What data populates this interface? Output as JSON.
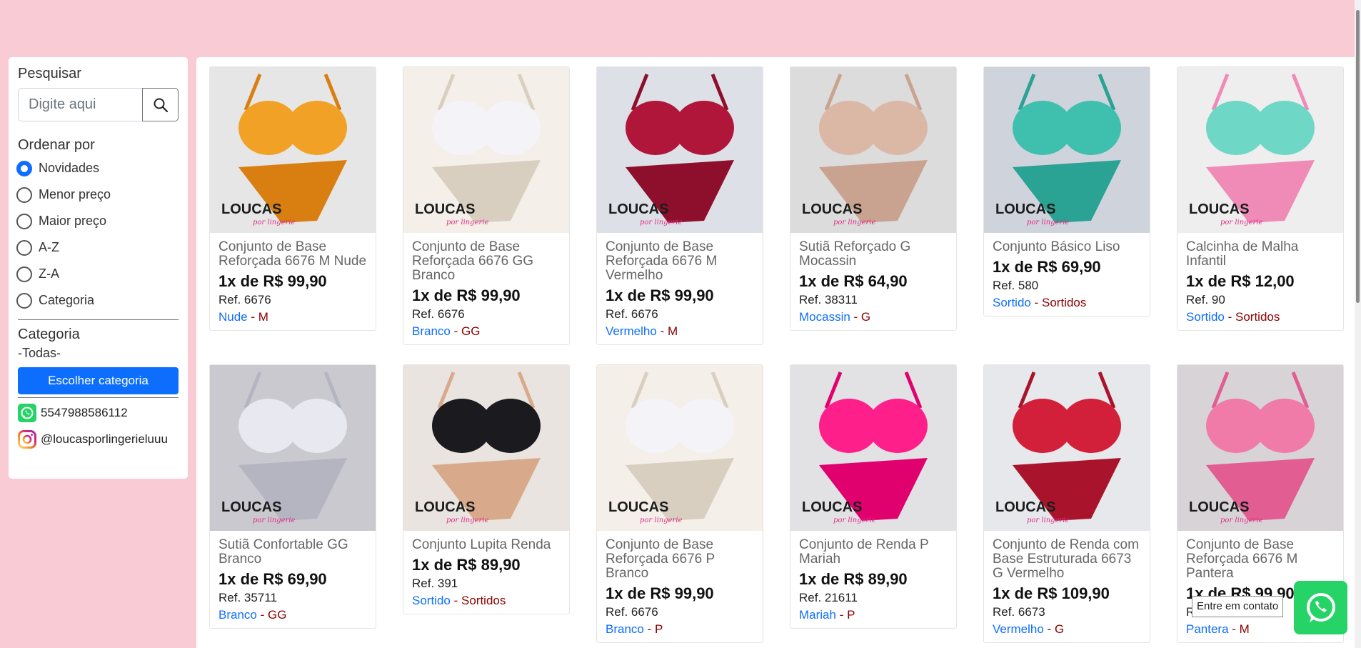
{
  "sidebar": {
    "search": {
      "heading": "Pesquisar",
      "placeholder": "Digite aqui"
    },
    "sort": {
      "heading": "Ordenar por",
      "options": [
        "Novidades",
        "Menor preço",
        "Maior preço",
        "A-Z",
        "Z-A",
        "Categoria"
      ],
      "selected": "Novidades"
    },
    "category": {
      "heading": "Categoria",
      "value": "-Todas-",
      "button": "Escolher categoria"
    },
    "contacts": {
      "whatsapp": "5547988586112",
      "instagram": "@loucasporlingerieluuu"
    }
  },
  "products": [
    {
      "title": "Conjunto de Base Reforçada 6676 M Nude",
      "price": "1x de R$ 99,90",
      "ref": "Ref. 6676",
      "color": "Nude",
      "sep": " - ",
      "size": "M",
      "image": {
        "bg": "#e6e6e6",
        "main": "#f2a127",
        "accent": "#d97f12"
      }
    },
    {
      "title": "Conjunto de Base Reforçada 6676 GG Branco",
      "price": "1x de R$ 99,90",
      "ref": "Ref. 6676",
      "color": "Branco",
      "sep": " - ",
      "size": "GG",
      "image": {
        "bg": "#f4efe8",
        "main": "#f4f4f8",
        "accent": "#d8cfc0"
      }
    },
    {
      "title": "Conjunto de Base Reforçada 6676 M Vermelho",
      "price": "1x de R$ 99,90",
      "ref": "Ref. 6676",
      "color": "Vermelho",
      "sep": " - ",
      "size": "M",
      "image": {
        "bg": "#dde0e6",
        "main": "#b0163a",
        "accent": "#8d0f2c"
      }
    },
    {
      "title": "Sutiã Reforçado G Mocassin",
      "price": "1x de R$ 64,90",
      "ref": "Ref. 38311",
      "color": "Mocassin",
      "sep": " - ",
      "size": "G",
      "image": {
        "bg": "#dcdcdc",
        "main": "#dbb8a6",
        "accent": "#c9a390"
      }
    },
    {
      "title": "Conjunto Básico Liso",
      "price": "1x de R$ 69,90",
      "ref": "Ref. 580",
      "color": "Sortido",
      "sep": " - ",
      "size": "Sortidos",
      "image": {
        "bg": "#cfd3dc",
        "main": "#3fbfae",
        "accent": "#2aa294"
      }
    },
    {
      "title": "Calcinha de Malha Infantil",
      "price": "1x de R$ 12,00",
      "ref": "Ref. 90",
      "color": "Sortido",
      "sep": " - ",
      "size": "Sortidos",
      "image": {
        "bg": "#eeeeee",
        "main": "#6fd7c6",
        "accent": "#f08bb8"
      }
    },
    {
      "title": "Sutiã Confortable GG Branco",
      "price": "1x de R$ 69,90",
      "ref": "Ref. 35711",
      "color": "Branco",
      "sep": " - ",
      "size": "GG",
      "image": {
        "bg": "#c9c9cf",
        "main": "#e8e8f0",
        "accent": "#b5b5c2"
      }
    },
    {
      "title": "Conjunto Lupita Renda",
      "price": "1x de R$ 89,90",
      "ref": "Ref. 391",
      "color": "Sortido",
      "sep": " - ",
      "size": "Sortidos",
      "image": {
        "bg": "#e9e4df",
        "main": "#1b1b1f",
        "accent": "#d8a98a"
      }
    },
    {
      "title": "Conjunto de Base Reforçada 6676 P Branco",
      "price": "1x de R$ 99,90",
      "ref": "Ref. 6676",
      "color": "Branco",
      "sep": " - ",
      "size": "P",
      "image": {
        "bg": "#f4efe8",
        "main": "#f4f4f8",
        "accent": "#d8cfc0"
      }
    },
    {
      "title": "Conjunto de Renda P Mariah",
      "price": "1x de R$ 89,90",
      "ref": "Ref. 21611",
      "color": "Mariah",
      "sep": " - ",
      "size": "P",
      "image": {
        "bg": "#e2e2e4",
        "main": "#ff1f8a",
        "accent": "#e0006e"
      }
    },
    {
      "title": "Conjunto de Renda com Base Estruturada 6673 G Vermelho",
      "price": "1x de R$ 109,90",
      "ref": "Ref. 6673",
      "color": "Vermelho",
      "sep": " - ",
      "size": "G",
      "image": {
        "bg": "#e6e8ec",
        "main": "#d2203a",
        "accent": "#a9142c"
      }
    },
    {
      "title": "Conjunto de Base Reforçada 6676 M Pantera",
      "price": "1x de R$ 99,90",
      "ref": "Ref. 6676",
      "color": "Pantera",
      "sep": " - ",
      "size": "M",
      "image": {
        "bg": "#d7d3d6",
        "main": "#f07aa8",
        "accent": "#e15d92"
      }
    }
  ],
  "brand_mark": {
    "name": "LOUCAS",
    "sub": "por lingerie"
  },
  "whatsapp_widget": {
    "tooltip": "Entre em contato"
  },
  "colors": {
    "page_bg": "#f9ccd5",
    "primary": "#0d6efd",
    "tag_secondary": "#8b0000",
    "whatsapp": "#25d366"
  }
}
